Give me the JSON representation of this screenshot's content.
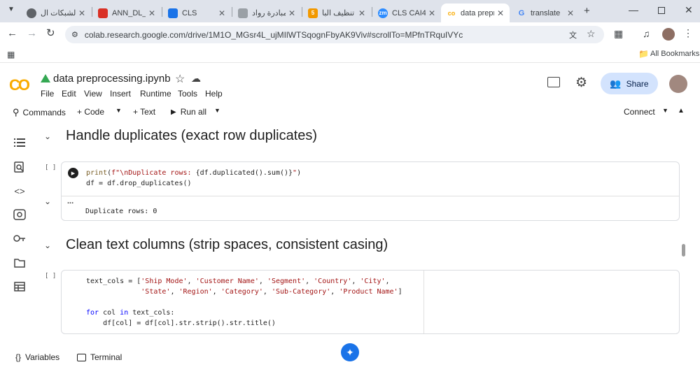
{
  "browser": {
    "tabs": [
      {
        "title": "الشبكات ال",
        "icon": "globe-icon",
        "color": "#5f6368"
      },
      {
        "title": "ANN_DL_A",
        "icon": "pdf-icon",
        "color": "#d93025"
      },
      {
        "title": "CLS",
        "icon": "docs-icon",
        "color": "#1a73e8"
      },
      {
        "title": "مبادرة رواد",
        "icon": "rowad-icon",
        "color": "#5f6368"
      },
      {
        "title": "تنظيف البا",
        "icon": "five-icon",
        "color": "#f29900"
      },
      {
        "title": "CLS CAI4",
        "icon": "zoom-icon",
        "color": "#2d8cff"
      },
      {
        "title": "data prepr",
        "icon": "colab-icon",
        "color": "#f9ab00"
      },
      {
        "title": "translate",
        "icon": "google-icon",
        "color": "#4285f4"
      }
    ],
    "url": "colab.research.google.com/drive/1M1O_MGsr4L_ujMIlWTSqognFbyAK9Viv#scrollTo=MPfnTRquIVYc",
    "bookmarks_label": "All Bookmarks"
  },
  "colab": {
    "notebook_title": "data preprocessing.ipynb",
    "menu": [
      "File",
      "Edit",
      "View",
      "Insert",
      "Runtime",
      "Tools",
      "Help"
    ],
    "share_label": "Share",
    "toolbar": {
      "commands": "Commands",
      "code": "+ Code",
      "text": "+ Text",
      "run_all": "Run all",
      "connect": "Connect"
    },
    "sections": [
      {
        "heading": "Handle duplicates (exact row duplicates)"
      },
      {
        "heading": "Clean text columns (strip spaces, consistent casing)"
      }
    ],
    "cell1": {
      "bracket": "[ ]",
      "output_ellipsis": "...",
      "output": "Duplicate rows: 0"
    },
    "cell2": {
      "bracket": "[ ]"
    },
    "status": {
      "variables": "Variables",
      "terminal": "Terminal"
    }
  }
}
